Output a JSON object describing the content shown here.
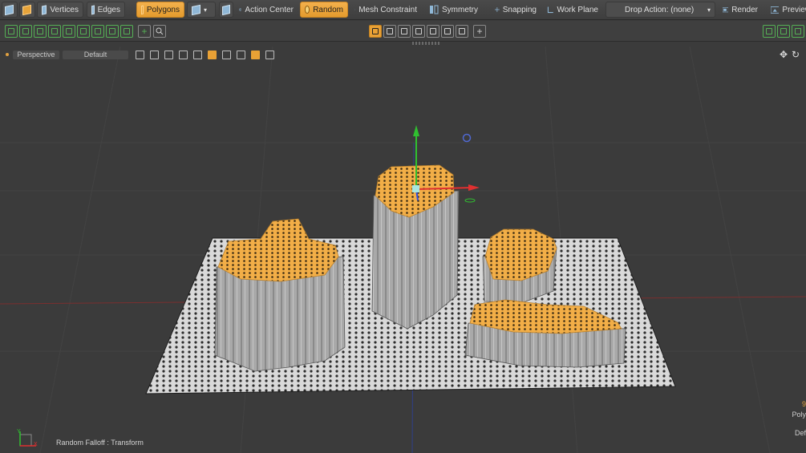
{
  "toolbar": {
    "vertices": "Vertices",
    "edges": "Edges",
    "polygons": "Polygons",
    "action_center": "Action Center",
    "random": "Random",
    "mesh_constraint": "Mesh Constraint",
    "symmetry": "Symmetry",
    "snapping": "Snapping",
    "work_plane": "Work Plane",
    "drop_action": "Drop Action: (none)",
    "render": "Render",
    "preview": "Preview"
  },
  "viewport": {
    "projection": "Perspective",
    "style": "Default",
    "status": "Random Falloff : Transform",
    "readout_top": "9",
    "readout_mid": "Poly",
    "readout_bottom": "Def"
  },
  "colors": {
    "accent": "#e9a135",
    "selection": "#f2ae47",
    "mesh": "#a9a9a9",
    "x_axis": "#e03030",
    "y_axis": "#30c030",
    "z_axis": "#3050e0"
  }
}
